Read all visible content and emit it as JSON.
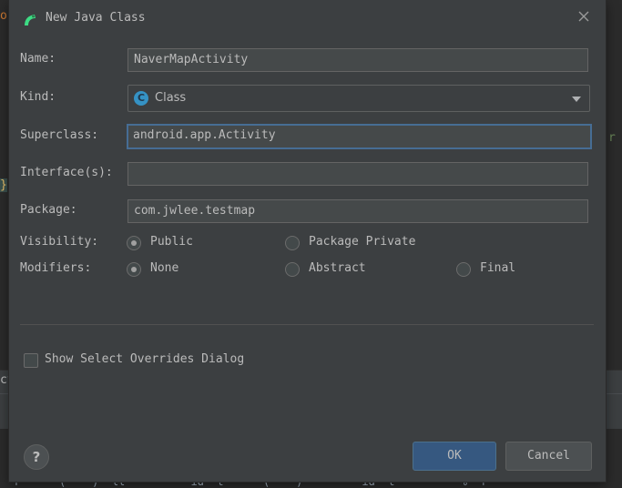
{
  "background": {
    "left_fragment_top": "ou",
    "left_fragment_mid": "}",
    "left_fragment_panel": "ct",
    "right_fragment": "r",
    "bottom_code": "  f      (    )  ll          id  t      (    )         id  t          %  f"
  },
  "dialog": {
    "title": "New Java Class",
    "title_icon": "android-studio-icon",
    "close_icon": "close-icon"
  },
  "form": {
    "name_label": "Name:",
    "name_value": "NaverMapActivity",
    "kind_label": "Kind:",
    "kind_value": "Class",
    "kind_icon_letter": "C",
    "superclass_label": "Superclass:",
    "superclass_value": "android.app.Activity",
    "interfaces_label": "Interface(s):",
    "interfaces_value": "",
    "package_label": "Package:",
    "package_value": "com.jwlee.testmap"
  },
  "visibility": {
    "label": "Visibility:",
    "options": [
      {
        "label": "Public",
        "checked": true
      },
      {
        "label": "Package Private",
        "checked": false
      }
    ]
  },
  "modifiers": {
    "label": "Modifiers:",
    "options": [
      {
        "label": "None",
        "checked": true
      },
      {
        "label": "Abstract",
        "checked": false
      },
      {
        "label": "Final",
        "checked": false
      }
    ]
  },
  "overrides": {
    "label": "Show Select Overrides Dialog",
    "checked": false
  },
  "buttons": {
    "help": "?",
    "ok": "OK",
    "cancel": "Cancel"
  },
  "colors": {
    "dialog_bg": "#3c3f41",
    "accent_focus": "#466d94",
    "ok_button": "#365880",
    "class_icon": "#3592c4",
    "title_icon": "#3ddc84"
  }
}
